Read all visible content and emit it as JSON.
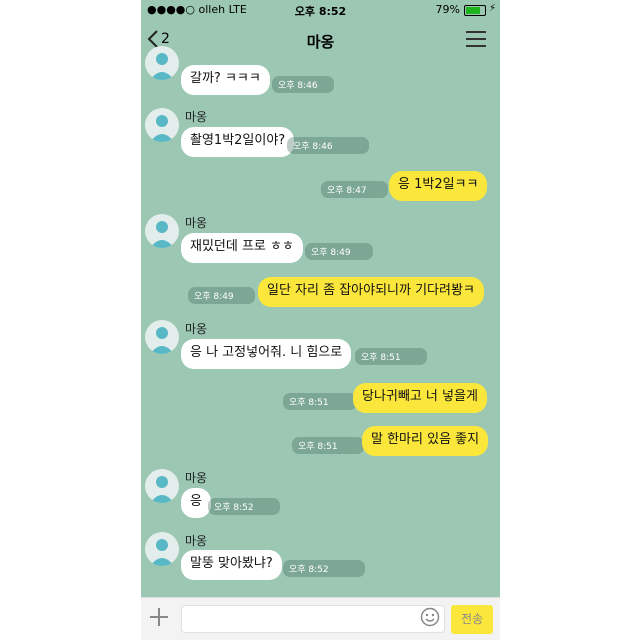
{
  "status": {
    "carrier": "●●●●○ olleh  LTE",
    "time": "오후 8:52",
    "battery": "79%",
    "battery_level": 0.79
  },
  "header": {
    "back_count": "2",
    "title": "마옹"
  },
  "messages": [
    {
      "text": "갈까? ㅋㅋㅋ",
      "time": "오후 8:46"
    },
    {
      "sender": "마옹",
      "text": "촬영1박2일이야?",
      "time": "오후 8:46"
    },
    {
      "text": "응 1박2일ㅋㅋ",
      "time": "오후 8:47"
    },
    {
      "sender": "마옹",
      "text": "재밌던데 프로 ㅎㅎ",
      "time": "오후 8:49"
    },
    {
      "text": "일단 자리 좀 잡아야되니까 기다려봥ㅋ",
      "time": "오후 8:49"
    },
    {
      "sender": "마옹",
      "text": "응 나 고정넣어줘. 니 힘으로",
      "time": "오후 8:51"
    },
    {
      "text": "당나귀빼고 너 넣을게",
      "time": "오후 8:51"
    },
    {
      "text": "말 한마리 있음 좋지",
      "time": "오후 8:51"
    },
    {
      "sender": "마옹",
      "text": "응",
      "time": "오후 8:52"
    },
    {
      "sender": "마옹",
      "text": "말뚱 맞아봤냐?",
      "time": "오후 8:52"
    }
  ],
  "input": {
    "send_label": "전송"
  },
  "colors": {
    "background": "#9bc7b3",
    "outgoing_bubble": "#fbe73c",
    "incoming_bubble": "#ffffff"
  }
}
